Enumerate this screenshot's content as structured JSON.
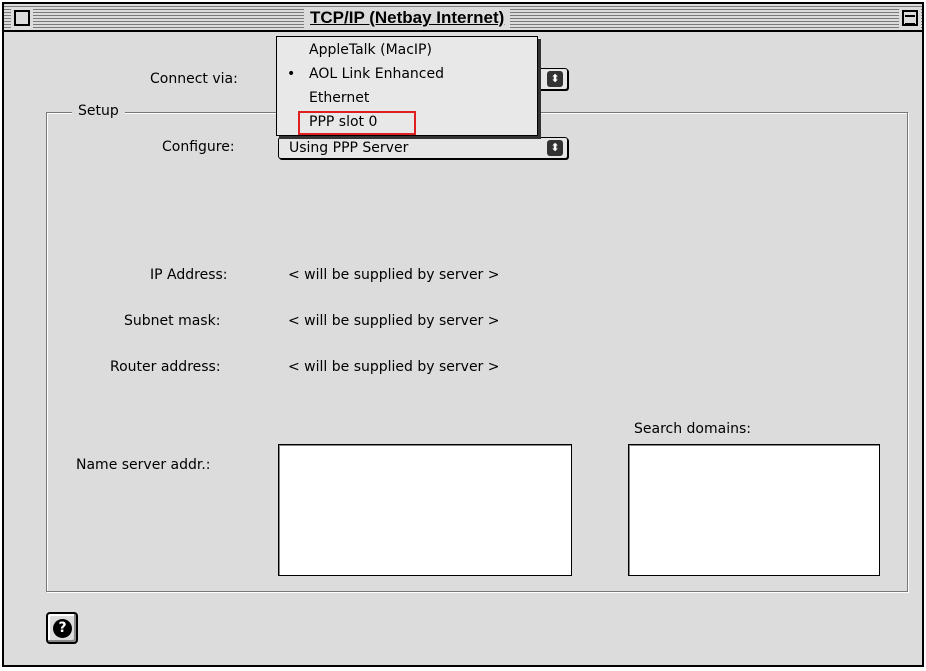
{
  "window": {
    "title": "TCP/IP (Netbay Internet)"
  },
  "connect_via": {
    "label": "Connect via:",
    "menu_items": [
      {
        "label": "AppleTalk (MacIP)",
        "checked": false
      },
      {
        "label": "AOL Link Enhanced",
        "checked": true
      },
      {
        "label": "Ethernet",
        "checked": false
      },
      {
        "label": "PPP slot 0",
        "checked": false,
        "highlighted": true
      }
    ],
    "check_glyph": "•"
  },
  "setup": {
    "group_label": "Setup",
    "configure_label": "Configure:",
    "configure_value": "Using PPP Server",
    "ip_label": "IP Address:",
    "ip_value": "< will be supplied by server >",
    "subnet_label": "Subnet mask:",
    "subnet_value": "< will be supplied by server >",
    "router_label": "Router address:",
    "router_value": "< will be supplied by server >",
    "name_server_label": "Name server addr.:",
    "name_server_value": "",
    "search_domains_label": "Search domains:",
    "search_domains_value": ""
  },
  "icons": {
    "popup_arrow": "⬍",
    "help": "?"
  },
  "colors": {
    "window_bg": "#dcdcdc",
    "highlight_border": "#e02020"
  }
}
